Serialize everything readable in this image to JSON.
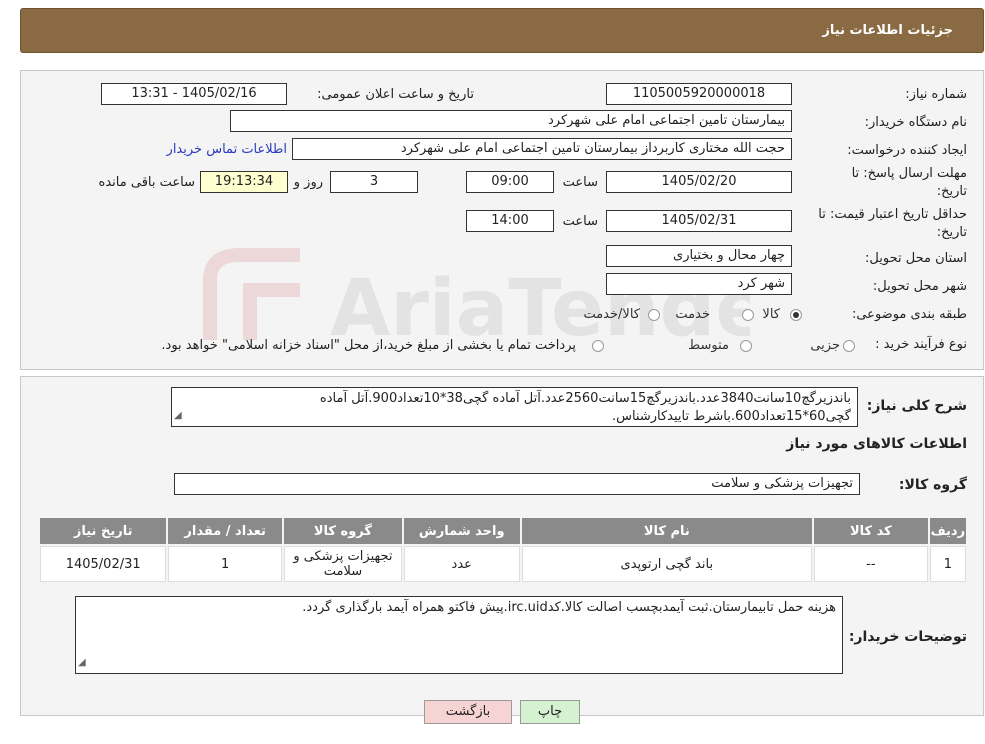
{
  "header": {
    "title": "جزئیات اطلاعات نیاز"
  },
  "form": {
    "need_number": {
      "label": "شماره نیاز:",
      "value": "1105005920000018"
    },
    "announce_datetime": {
      "label": "تاریخ و ساعت اعلان عمومی:",
      "value": "1405/02/16 - 13:31"
    },
    "buyer_org": {
      "label": "نام دستگاه خریدار:",
      "value": "بیمارستان تامین اجتماعی امام علی شهرکرد"
    },
    "requester": {
      "label": "ایجاد کننده درخواست:",
      "value": "حجت الله مختاری کاربرداز بیمارستان تامین اجتماعی امام علی شهرکرد",
      "contact_link": "اطلاعات تماس خریدار"
    },
    "deadline": {
      "label_line1": "مهلت ارسال پاسخ: تا",
      "label_line2": "تاریخ:",
      "date": "1405/02/20",
      "time_label": "ساعت",
      "time": "09:00",
      "days": "3",
      "days_label": "روز و",
      "remaining": "19:13:34",
      "remaining_label": "ساعت باقی مانده"
    },
    "validity": {
      "label_line1": "حداقل تاریخ اعتبار قیمت: تا",
      "label_line2": "تاریخ:",
      "date": "1405/02/31",
      "time_label": "ساعت",
      "time": "14:00"
    },
    "province": {
      "label": "استان محل تحویل:",
      "value": "چهار محال و بختیاری"
    },
    "city": {
      "label": "شهر محل تحویل:",
      "value": "شهر کرد"
    },
    "category": {
      "label": "طبقه بندی موضوعی:",
      "options": [
        "کالا",
        "خدمت",
        "کالا/خدمت"
      ],
      "selected": "کالا"
    },
    "purchase_type": {
      "label": "نوع فرآیند خرید :",
      "options": [
        "جزیی",
        "متوسط"
      ],
      "note": "پرداخت تمام یا بخشی از مبلغ خرید،از محل \"اسناد خزانه اسلامی\" خواهد بود."
    }
  },
  "description": {
    "label": "شرح کلی نیاز:",
    "line1": "باندزیرگچ10سانت3840عدد.باندزیرگچ15سانت2560عدد.آتل آماده گچی38*10تعداد900.آتل آماده",
    "line2": "گچی60*15تعداد600.باشرط تاییدکارشناس."
  },
  "goods": {
    "section_title": "اطلاعات کالاهای مورد نیاز",
    "group_label": "گروه کالا:",
    "group_value": "تجهیزات پزشکی و سلامت",
    "table": {
      "headers": [
        "ردیف",
        "کد کالا",
        "نام کالا",
        "واحد شمارش",
        "گروه کالا",
        "تعداد / مقدار",
        "تاریخ نیاز"
      ],
      "rows": [
        [
          "1",
          "--",
          "باند گچی ارتوپدی",
          "عدد",
          "تجهیزات پزشکی و سلامت",
          "1",
          "1405/02/31"
        ]
      ]
    }
  },
  "buyer_notes": {
    "label": "توضیحات خریدار:",
    "value": "هزینه حمل تابیمارستان.ثبت آیمدبچسب اصالت کالا.کدirc.uid.پیش فاکتو همراه آیمد بارگذاری گردد."
  },
  "buttons": {
    "print": "چاپ",
    "back": "بازگشت"
  },
  "watermark": {
    "text": "AriaTender.neT"
  }
}
